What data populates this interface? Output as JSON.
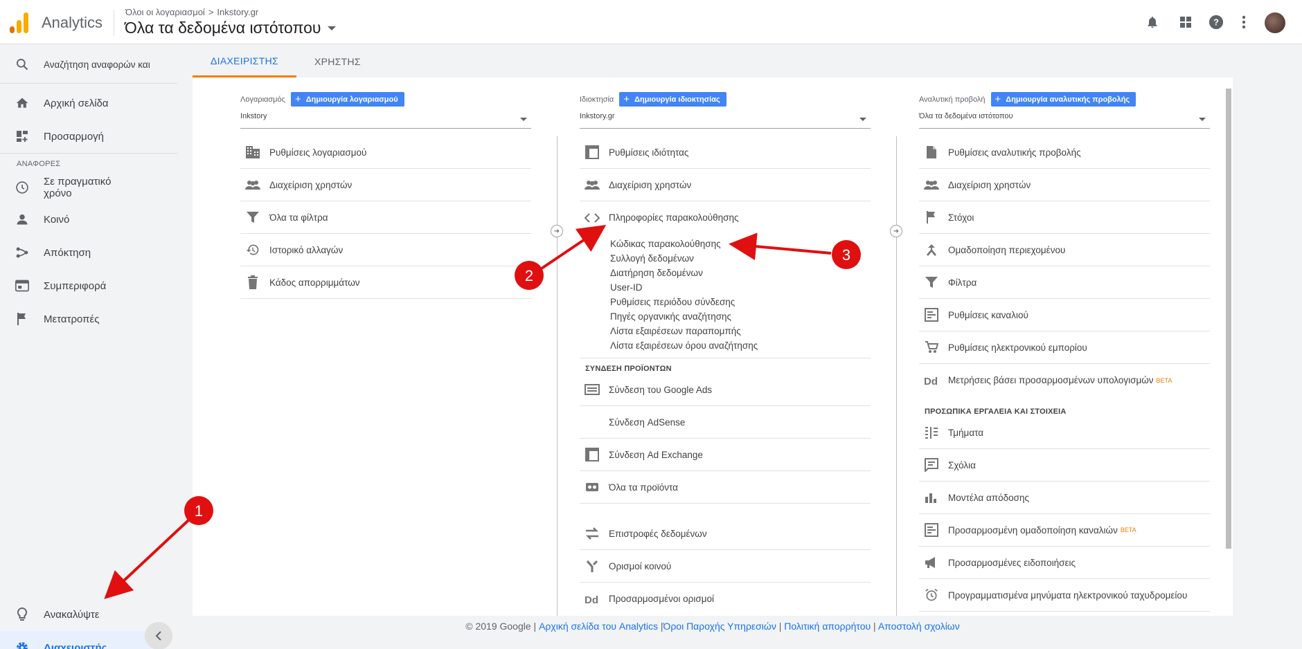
{
  "header": {
    "app_name": "Analytics",
    "breadcrumb": {
      "account": "Όλοι οι λογαριασμοί",
      "separator": ">",
      "property": "Inkstory.gr"
    },
    "view_title": "Όλα τα δεδομένα ιστότοπου",
    "icons": [
      "notifications-icon",
      "apps-icon",
      "help-icon",
      "more-vert-icon",
      "avatar"
    ]
  },
  "sidebar": {
    "search_label": "Αναζήτηση αναφορών και",
    "home": "Αρχική σελίδα",
    "customization": "Προσαρμογή",
    "reports_section": "ΑΝΑΦΟΡΕΣ",
    "realtime_1": "Σε πραγματικό",
    "realtime_2": "χρόνο",
    "audience": "Κοινό",
    "acquisition": "Απόκτηση",
    "behavior": "Συμπεριφορά",
    "conversions": "Μετατροπές",
    "discover": "Ανακαλύψτε",
    "admin": "Διαχειριστής"
  },
  "tabs": {
    "admin": "ΔΙΑΧΕΙΡΙΣΤΗΣ",
    "user": "ΧΡΗΣΤΗΣ"
  },
  "account_col": {
    "label": "Λογαριασμός",
    "create": "Δημιουργία λογαριασμού",
    "selected": "Inkstory",
    "items": [
      "Ρυθμίσεις λογαριασμού",
      "Διαχείριση χρηστών",
      "Όλα τα φίλτρα",
      "Ιστορικό αλλαγών",
      "Κάδος απορριμμάτων"
    ]
  },
  "property_col": {
    "label": "Ιδιοκτησία",
    "create": "Δημιουργία ιδιοκτησίας",
    "selected": "Inkstory.gr",
    "items": [
      "Ρυθμίσεις ιδιότητας",
      "Διαχείριση χρηστών",
      "Πληροφορίες παρακολούθησης"
    ],
    "tracking_sublinks": [
      "Κώδικας παρακολούθησης",
      "Συλλογή δεδομένων",
      "Διατήρηση δεδομένων",
      "User-ID",
      "Ρυθμίσεις περιόδου σύνδεσης",
      "Πηγές οργανικής αναζήτησης",
      "Λίστα εξαιρέσεων παραπομπής",
      "Λίστα εξαιρέσεων όρου αναζήτησης"
    ],
    "linking_section": "ΣΥΝΔΕΣΗ ΠΡΟΪΟΝΤΩΝ",
    "linking_items": [
      "Σύνδεση του Google Ads",
      "Σύνδεση AdSense",
      "Σύνδεση Ad Exchange",
      "Όλα τα προϊόντα"
    ],
    "more_items": [
      "Επιστροφές δεδομένων",
      "Ορισμοί κοινού",
      "Προσαρμοσμένοι ορισμοί"
    ]
  },
  "view_col": {
    "label": "Αναλυτική προβολή",
    "create": "Δημιουργία αναλυτικής προβολής",
    "selected": "Όλα τα δεδομένα ιστότοπου",
    "items": [
      "Ρυθμίσεις αναλυτικής προβολής",
      "Διαχείριση χρηστών",
      "Στόχοι",
      "Ομαδοποίηση περιεχομένου",
      "Φίλτρα",
      "Ρυθμίσεις καναλιού",
      "Ρυθμίσεις ηλεκτρονικού εμπορίου",
      "Μετρήσεις βάσει προσαρμοσμένων υπολογισμών"
    ],
    "beta": "BETA",
    "personal_section": "ΠΡΟΣΩΠΙΚΑ ΕΡΓΑΛΕΙΑ ΚΑΙ ΣΤΟΙΧΕΙΑ",
    "personal_items": [
      "Τμήματα",
      "Σχόλια",
      "Μοντέλα απόδοσης",
      "Προσαρμοσμένη ομαδοποίηση καναλιών",
      "Προσαρμοσμένες ειδοποιήσεις",
      "Προγραμματισμένα μηνύματα ηλεκτρονικού ταχυδρομείου"
    ]
  },
  "footer": {
    "copyright": "© 2019 Google |",
    "links": [
      "Αρχική σελίδα του Analytics",
      "Όροι Παροχής Υπηρεσιών",
      "Πολιτική απορρήτου",
      "Αποστολή σχολίων"
    ],
    "sep": "|"
  },
  "annotations": {
    "one": "1",
    "two": "2",
    "three": "3",
    "color": "#e01010"
  },
  "colors": {
    "accent": "#1a73e8",
    "tab_underline": "#f57c00",
    "button": "#4285f4",
    "beta": "#f57c00"
  }
}
